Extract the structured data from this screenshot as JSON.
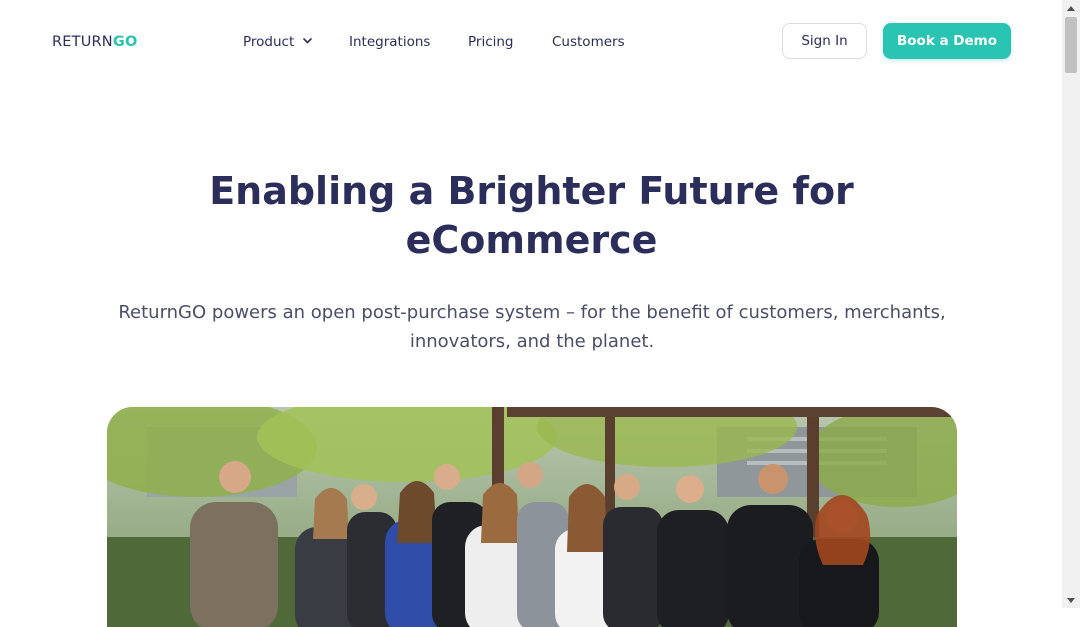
{
  "header": {
    "logo": {
      "part1": "RETURN",
      "part2": "GO"
    },
    "nav": [
      {
        "label": "Product",
        "has_dropdown": true
      },
      {
        "label": "Integrations"
      },
      {
        "label": "Pricing"
      },
      {
        "label": "Customers"
      }
    ],
    "sign_in_label": "Sign In",
    "demo_label": "Book a Demo"
  },
  "hero": {
    "title_line1": "Enabling a Brighter Future for",
    "title_line2": "eCommerce",
    "subtitle_line1": "ReturnGO powers an open post-purchase system – for the benefit of customers, merchants,",
    "subtitle_line2": "innovators, and the planet."
  },
  "photo": {
    "subject": "team-photo",
    "people_count": 12
  },
  "colors": {
    "brand_navy": "#2b2d5b",
    "accent_teal": "#2ac4b3",
    "body_text": "#4a4e6a",
    "background": "#ffffff"
  },
  "icons": {
    "dropdown": "chevron-down-icon",
    "scroll_up": "scroll-up-arrow-icon",
    "scroll_down": "scroll-down-arrow-icon"
  }
}
